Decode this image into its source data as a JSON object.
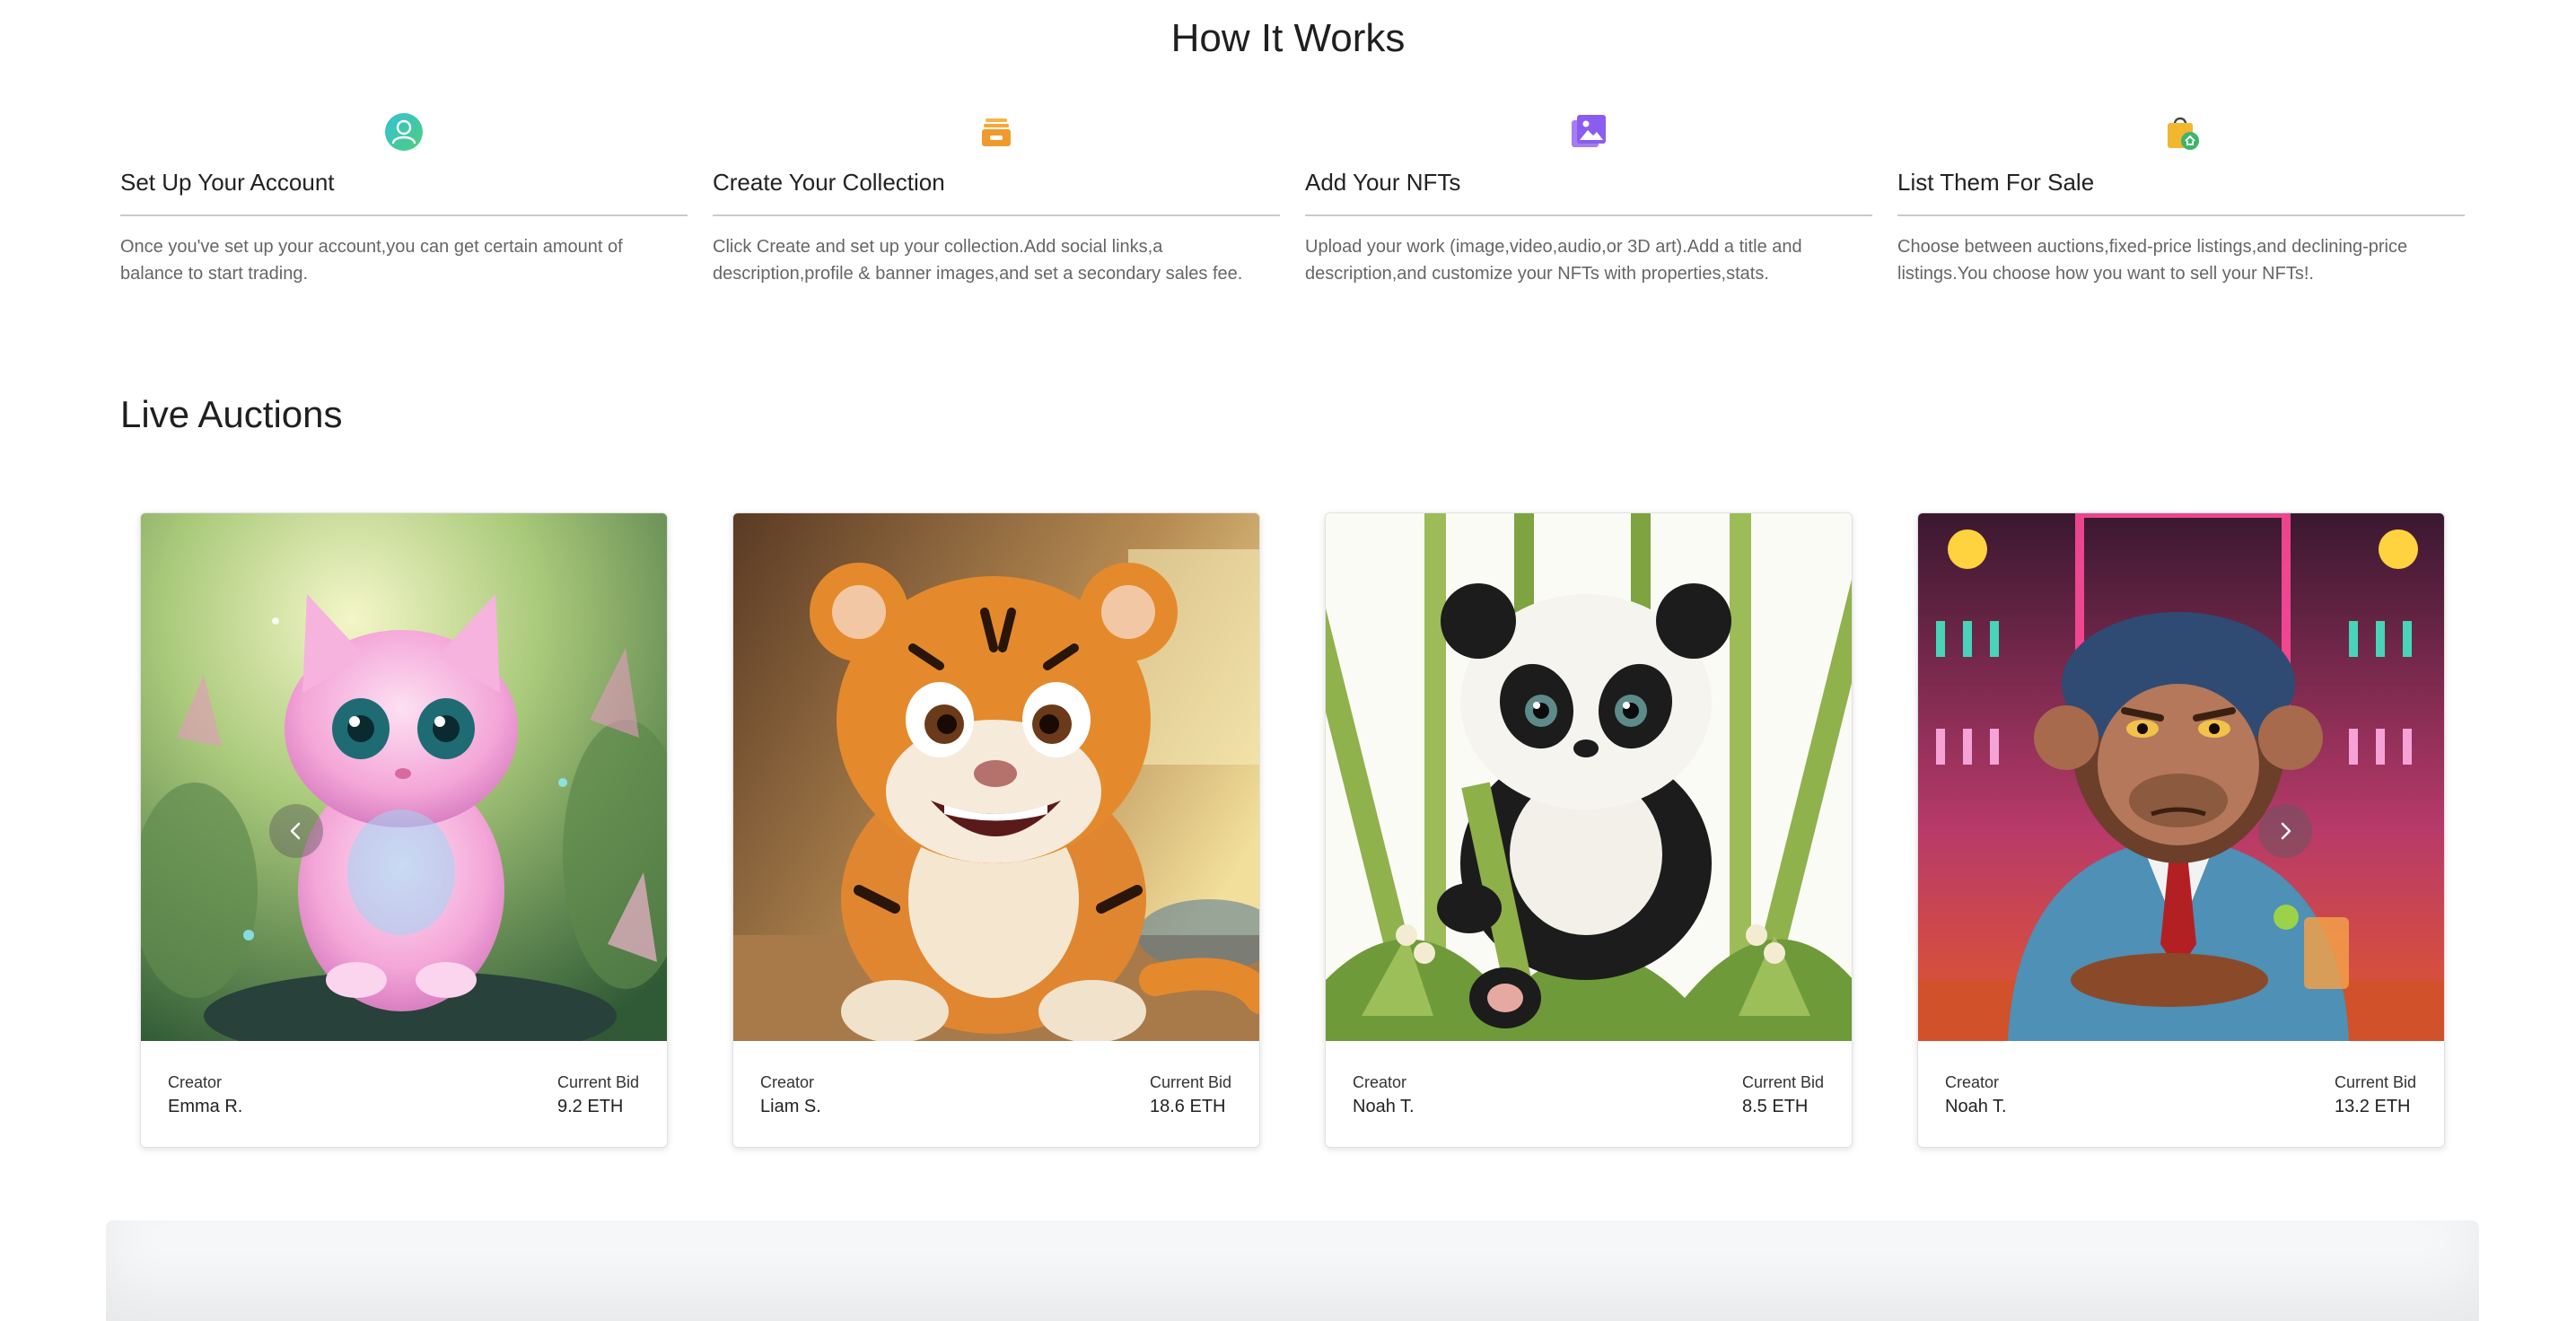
{
  "how_it_works": {
    "title": "How It Works",
    "steps": [
      {
        "icon": "user-icon",
        "title": "Set Up Your Account",
        "description": "Once you've set up your account,you can get certain amount of balance to start trading."
      },
      {
        "icon": "collection-icon",
        "title": "Create Your Collection",
        "description": "Click Create and set up your collection.Add social links,a description,profile & banner images,and set a secondary sales fee."
      },
      {
        "icon": "image-gallery-icon",
        "title": "Add Your NFTs",
        "description": "Upload your work (image,video,audio,or 3D art).Add a title and description,and customize your NFTs with properties,stats."
      },
      {
        "icon": "shopping-bag-icon",
        "title": "List Them For Sale",
        "description": "Choose between auctions,fixed-price listings,and declining-price listings.You choose how you want to sell your NFTs!."
      }
    ]
  },
  "live_auctions": {
    "title": "Live Auctions",
    "cards": [
      {
        "artwork": "pink-kitten",
        "creator_label": "Creator",
        "creator": "Emma R.",
        "bid_label": "Current Bid",
        "bid": "9.2 ETH"
      },
      {
        "artwork": "tiger-cub",
        "creator_label": "Creator",
        "creator": "Liam S.",
        "bid_label": "Current Bid",
        "bid": "18.6 ETH"
      },
      {
        "artwork": "panda-bamboo",
        "creator_label": "Creator",
        "creator": "Noah T.",
        "bid_label": "Current Bid",
        "bid": "8.5 ETH"
      },
      {
        "artwork": "monkey-bar",
        "creator_label": "Creator",
        "creator": "Noah T.",
        "bid_label": "Current Bid",
        "bid": "13.2 ETH"
      }
    ],
    "prev_icon": "chevron-left-icon",
    "next_icon": "chevron-right-icon"
  },
  "colors": {
    "user_icon": "#3bb8a0",
    "collection_icon": "#f0a030",
    "gallery_icon": "#8a5cf0",
    "bag_icon": "#f2b630"
  }
}
